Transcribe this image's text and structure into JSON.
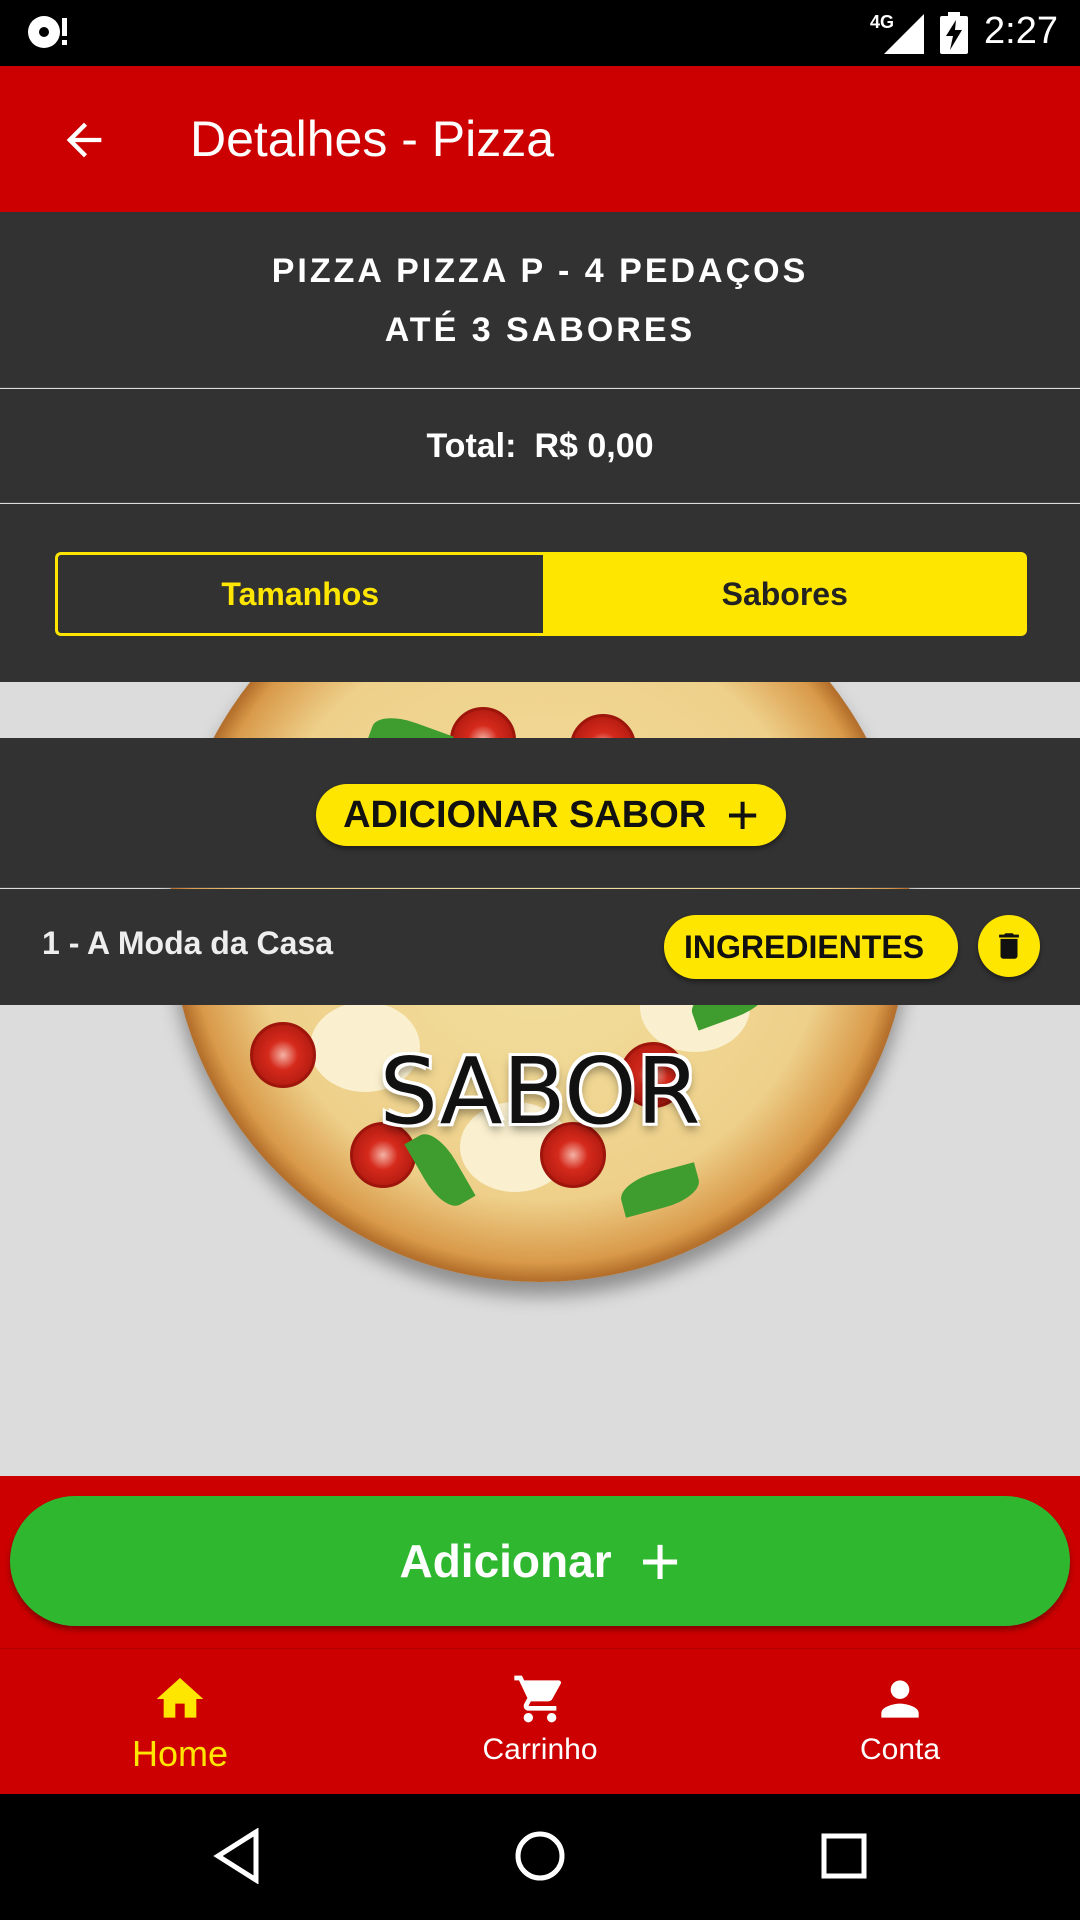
{
  "status_bar": {
    "time": "2:27",
    "network": "4G"
  },
  "app_bar": {
    "title": "Detalhes - Pizza"
  },
  "product": {
    "name_line1": "PIZZA PIZZA P - 4 PEDAÇOS",
    "name_line2": "ATÉ 3 SABORES"
  },
  "total": {
    "label": "Total:",
    "value": "R$ 0,00"
  },
  "tabs": {
    "sizes": "Tamanhos",
    "flavors": "Sabores",
    "selected": "Sabores"
  },
  "hero": {
    "overlay_text": "SABOR"
  },
  "add_flavor": {
    "label": "ADICIONAR SABOR",
    "icon": "plus-icon"
  },
  "flavors": [
    {
      "label": "1 - A Moda da Casa",
      "ingredients_label": "INGREDIENTES",
      "delete_icon": "trash-icon"
    }
  ],
  "add_button": {
    "label": "Adicionar",
    "icon": "plus-icon"
  },
  "bottom_nav": [
    {
      "label": "Home",
      "icon": "home-icon",
      "active": true
    },
    {
      "label": "Carrinho",
      "icon": "cart-icon",
      "active": false
    },
    {
      "label": "Conta",
      "icon": "person-icon",
      "active": false
    }
  ],
  "colors": {
    "brand_red": "#cc0000",
    "accent_yellow": "#ffe600",
    "panel_dark": "#323232",
    "add_green": "#2fb82f"
  }
}
